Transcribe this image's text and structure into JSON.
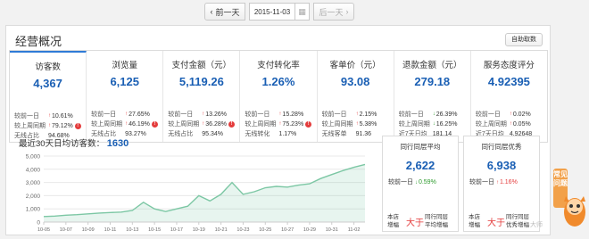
{
  "datenav": {
    "prev": "前一天",
    "date": "2015-11-03",
    "next": "后一天"
  },
  "panel": {
    "title": "经营概况",
    "auto_button": "自助取数"
  },
  "metrics": [
    {
      "title": "访客数",
      "value": "4,367",
      "active": true,
      "rows": [
        {
          "label": "较前一日",
          "dir": "up",
          "value": "10.61%",
          "warn": false
        },
        {
          "label": "较上周同期",
          "dir": "up",
          "value": "79.12%",
          "warn": true
        },
        {
          "label": "无线占比",
          "dir": "",
          "value": "94.68%",
          "warn": false
        }
      ]
    },
    {
      "title": "浏览量",
      "value": "6,125",
      "active": false,
      "rows": [
        {
          "label": "较前一日",
          "dir": "up",
          "value": "27.65%",
          "warn": false
        },
        {
          "label": "较上周同期",
          "dir": "up",
          "value": "46.19%",
          "warn": true
        },
        {
          "label": "无线占比",
          "dir": "",
          "value": "93.27%",
          "warn": false
        }
      ]
    },
    {
      "title": "支付金额（元）",
      "value": "5,119.26",
      "active": false,
      "rows": [
        {
          "label": "较前一日",
          "dir": "up",
          "value": "13.26%",
          "warn": false
        },
        {
          "label": "较上周同期",
          "dir": "up",
          "value": "36.28%",
          "warn": true
        },
        {
          "label": "无线占比",
          "dir": "",
          "value": "95.34%",
          "warn": false
        }
      ]
    },
    {
      "title": "支付转化率",
      "value": "1.26%",
      "active": false,
      "rows": [
        {
          "label": "较前一日",
          "dir": "up",
          "value": "15.28%",
          "warn": false
        },
        {
          "label": "较上周同期",
          "dir": "up",
          "value": "75.23%",
          "warn": true
        },
        {
          "label": "无线转化",
          "dir": "",
          "value": "1.17%",
          "warn": false
        }
      ]
    },
    {
      "title": "客单价（元）",
      "value": "93.08",
      "active": false,
      "rows": [
        {
          "label": "较前一日",
          "dir": "up",
          "value": "2.15%",
          "warn": false
        },
        {
          "label": "较上周同期",
          "dir": "up",
          "value": "5.38%",
          "warn": false
        },
        {
          "label": "无线客单",
          "dir": "",
          "value": "91.36",
          "warn": false
        }
      ]
    },
    {
      "title": "退款金额（元）",
      "value": "279.18",
      "active": false,
      "rows": [
        {
          "label": "较前一日",
          "dir": "dn",
          "value": "26.39%",
          "warn": false
        },
        {
          "label": "较上周同期",
          "dir": "dn",
          "value": "16.25%",
          "warn": false
        },
        {
          "label": "近7天日均",
          "dir": "",
          "value": "181.14",
          "warn": false
        }
      ]
    },
    {
      "title": "服务态度评分",
      "value": "4.92395",
      "active": false,
      "rows": [
        {
          "label": "较前一日",
          "dir": "up",
          "value": "0.02%",
          "warn": false
        },
        {
          "label": "较上周同期",
          "dir": "up",
          "value": "0.05%",
          "warn": false
        },
        {
          "label": "近7天日均",
          "dir": "",
          "value": "4.92648",
          "warn": false
        }
      ]
    }
  ],
  "chart_header": {
    "label": "最近30天日均访客数：",
    "value": "1630"
  },
  "chart_data": {
    "type": "area",
    "x": [
      "10-05",
      "10-06",
      "10-07",
      "10-08",
      "10-09",
      "10-10",
      "10-11",
      "10-12",
      "10-13",
      "10-14",
      "10-15",
      "10-16",
      "10-17",
      "10-18",
      "10-19",
      "10-20",
      "10-21",
      "10-22",
      "10-23",
      "10-24",
      "10-25",
      "10-26",
      "10-27",
      "10-28",
      "10-29",
      "10-30",
      "10-31",
      "11-01",
      "11-02",
      "11-03"
    ],
    "x_tick_labels": [
      "10-05",
      "10-07",
      "10-09",
      "10-11",
      "10-13",
      "10-15",
      "10-17",
      "10-19",
      "10-21",
      "10-23",
      "10-25",
      "10-27",
      "10-29",
      "10-31",
      "11-02"
    ],
    "values": [
      420,
      450,
      520,
      560,
      620,
      680,
      720,
      760,
      880,
      1500,
      1000,
      800,
      1000,
      1200,
      2000,
      1600,
      2100,
      3000,
      2100,
      2300,
      2600,
      2700,
      2650,
      2800,
      2900,
      3300,
      3600,
      3900,
      4150,
      4367
    ],
    "ylim": [
      0,
      5000
    ],
    "y_ticks": [
      "0",
      "1,000",
      "2,000",
      "3,000",
      "4,000",
      "5,000"
    ],
    "grid": true,
    "color": "#7cc7a4"
  },
  "compare": [
    {
      "title": "同行同层平均",
      "value": "2,622",
      "row_label": "较前一日",
      "row_dir": "dn",
      "row_value": "0.59%",
      "left_label": "本店\n增幅",
      "mid": "大于",
      "right_label": "同行同层\n平均增幅"
    },
    {
      "title": "同行同层优秀",
      "value": "6,938",
      "row_label": "较前一日",
      "row_dir": "up",
      "row_value": "1.16%",
      "left_label": "本店\n增幅",
      "mid": "大于",
      "right_label": "同行同层\n优秀增幅"
    }
  ],
  "source": "卜大师",
  "faq": "常见问题",
  "colors": {
    "accent": "#1a5fb4",
    "up": "#e43c3c",
    "down": "#2d9a2d",
    "area": "#7cc7a4"
  }
}
